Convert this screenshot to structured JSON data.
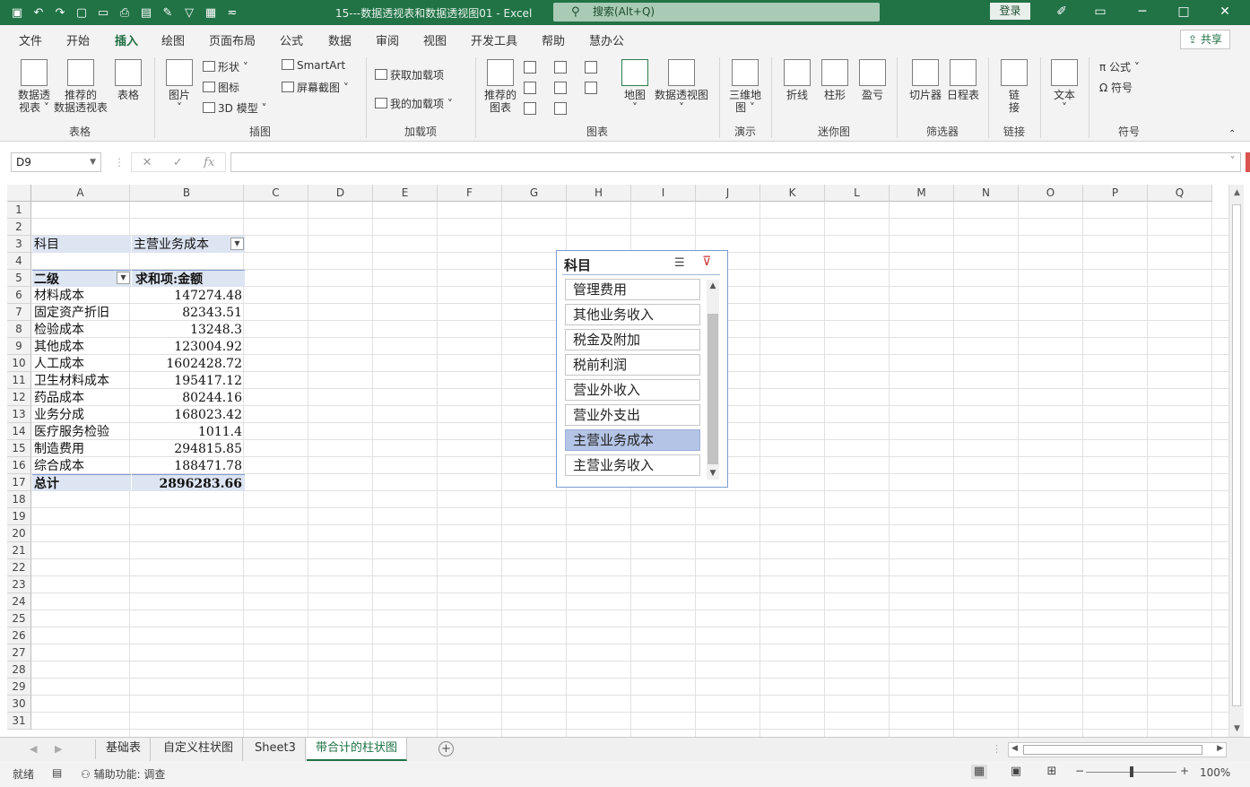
{
  "window": {
    "doc_title": "15---数据透视表和数据透视图01  -  Excel",
    "search_placeholder": "搜索(Alt+Q)",
    "login": "登录"
  },
  "menu": {
    "tabs": [
      "文件",
      "开始",
      "插入",
      "绘图",
      "页面布局",
      "公式",
      "数据",
      "审阅",
      "视图",
      "开发工具",
      "帮助",
      "慧办公"
    ],
    "active": "插入",
    "share": "共享"
  },
  "ribbon": {
    "groups": [
      "表格",
      "插图",
      "加载项",
      "图表",
      "演示",
      "迷你图",
      "筛选器",
      "链接",
      "符号"
    ],
    "table": {
      "pivot": [
        "数据透",
        "视表 ˅"
      ],
      "recommended_pivot": [
        "推荐的",
        "数据透视表"
      ],
      "table": "表格"
    },
    "illustrations": {
      "picture": "图片",
      "shapes": "形状 ˅",
      "icons": "图标",
      "model3d": "3D 模型  ˅",
      "smartart": "SmartArt",
      "screenshot": "屏幕截图 ˅"
    },
    "addins": {
      "get": "获取加载项",
      "my": "我的加载项  ˅"
    },
    "charts": {
      "recommended": [
        "推荐的",
        "图表"
      ],
      "map": "地图",
      "pivotchart": "数据透视图"
    },
    "tours": {
      "map3d": [
        "三维地",
        "图 ˅"
      ]
    },
    "sparklines": {
      "line": "折线",
      "column": "柱形",
      "winloss": "盈亏"
    },
    "filters": {
      "slicer": "切片器",
      "timeline": "日程表"
    },
    "links": {
      "link": [
        "链",
        "接"
      ]
    },
    "text": {
      "text": "文本"
    },
    "symbols": {
      "equation": "公式  ˅",
      "symbol": "符号"
    }
  },
  "formula": {
    "namebox": "D9",
    "cancel": "✕",
    "enter": "✓",
    "fx": "fx",
    "value": ""
  },
  "grid": {
    "columns": [
      "A",
      "B",
      "C",
      "D",
      "E",
      "F",
      "G",
      "H",
      "I",
      "J",
      "K",
      "L",
      "M",
      "N",
      "O",
      "P",
      "Q"
    ],
    "rows": [
      "1",
      "2",
      "3",
      "4",
      "5",
      "6",
      "7",
      "8",
      "9",
      "10",
      "11",
      "12",
      "13",
      "14",
      "15",
      "16",
      "17",
      "18",
      "19",
      "20",
      "21",
      "22",
      "23",
      "24",
      "25",
      "26",
      "27",
      "28",
      "29",
      "30",
      "31"
    ]
  },
  "pivot": {
    "filter_label": "科目",
    "filter_value": "主营业务成本",
    "row_header": "二级",
    "value_header": "求和项:金额",
    "rows": [
      {
        "label": "材料成本",
        "value": "147274.48"
      },
      {
        "label": "固定资产折旧",
        "value": "82343.51"
      },
      {
        "label": "检验成本",
        "value": "13248.3"
      },
      {
        "label": "其他成本",
        "value": "123004.92"
      },
      {
        "label": "人工成本",
        "value": "1602428.72"
      },
      {
        "label": "卫生材料成本",
        "value": "195417.12"
      },
      {
        "label": "药品成本",
        "value": "80244.16"
      },
      {
        "label": "业务分成",
        "value": "168023.42"
      },
      {
        "label": "医疗服务检验",
        "value": "1011.4"
      },
      {
        "label": "制造费用",
        "value": "294815.85"
      },
      {
        "label": "综合成本",
        "value": "188471.78"
      }
    ],
    "total_label": "总计",
    "total_value": "2896283.66"
  },
  "slicer": {
    "title": "科目",
    "items": [
      "管理费用",
      "其他业务收入",
      "税金及附加",
      "税前利润",
      "营业外收入",
      "营业外支出",
      "主营业务成本",
      "主营业务收入"
    ],
    "selected": "主营业务成本"
  },
  "sheets": {
    "tabs": [
      "基础表",
      "自定义柱状图",
      "Sheet3",
      "带合计的柱状图"
    ],
    "active": "带合计的柱状图"
  },
  "status": {
    "ready": "就绪",
    "accessibility": "辅助功能: 调查",
    "zoom": "100%"
  }
}
